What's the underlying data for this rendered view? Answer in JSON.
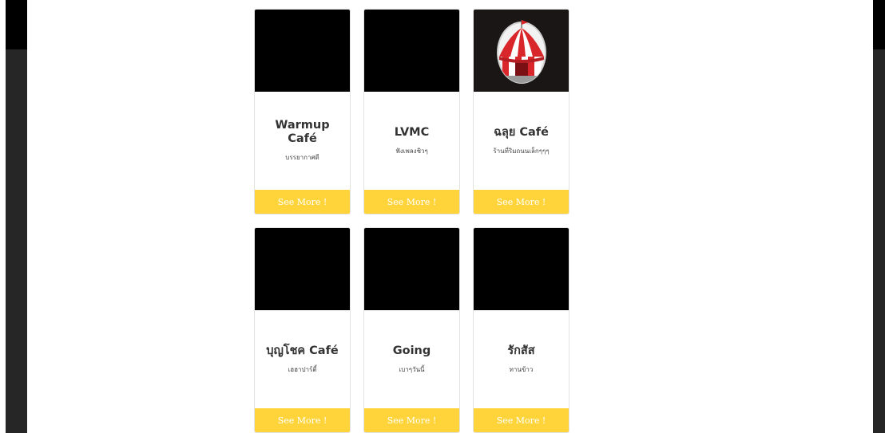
{
  "cards": [
    {
      "name": "Warmup Café",
      "description": "บรรยากาศดี",
      "button_label": "See More !",
      "has_image": false
    },
    {
      "name": "LVMC",
      "description": "ฟังเพลงชิวๆ",
      "button_label": "See More !",
      "has_image": false
    },
    {
      "name": "ฉลุย Café",
      "description": "ร้านที่ริมถนนเล็กๆๆๆ",
      "button_label": "See More !",
      "has_image": true,
      "image_icon": "circus-tent-icon"
    },
    {
      "name": "บุญโชค Café",
      "description": "เฮฮาปาร์ตี้",
      "button_label": "See More !",
      "has_image": false
    },
    {
      "name": "Going",
      "description": "เบาๆวันนี้",
      "button_label": "See More !",
      "has_image": false
    },
    {
      "name": "รักสัส",
      "description": "ทานข้าว",
      "button_label": "See More !",
      "has_image": false
    }
  ],
  "colors": {
    "button": "#ffd43b",
    "button_text": "#ffffff",
    "sidebar": "#262626",
    "thumb": "#000000"
  }
}
